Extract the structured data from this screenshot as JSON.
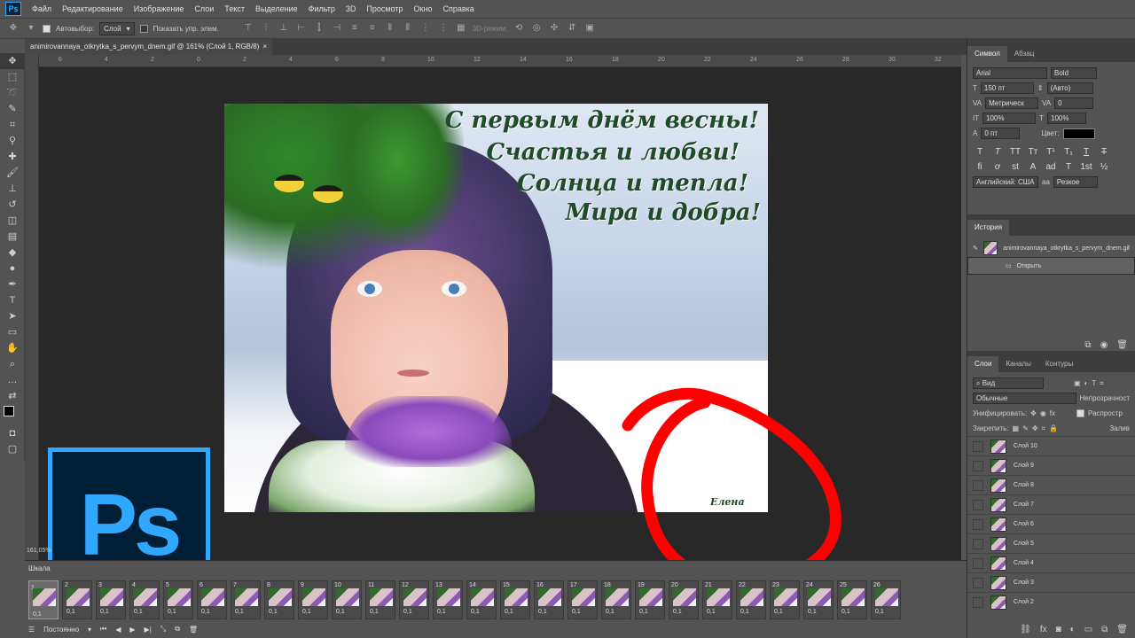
{
  "app": {
    "logo": "Ps"
  },
  "menu": [
    "Файл",
    "Редактирование",
    "Изображение",
    "Слои",
    "Текст",
    "Выделение",
    "Фильтр",
    "3D",
    "Просмотр",
    "Окно",
    "Справка"
  ],
  "options": {
    "autoselect_label": "Автовыбор:",
    "autoselect_value": "Слой",
    "show_controls_label": "Показать упр. элем.",
    "mode3d_label": "3D-режим:"
  },
  "document": {
    "tab_title": "animirovannaya_otkrytka_s_pervym_dnem.gif @ 161% (Слой 1, RGB/8)",
    "zoom_status": "161,05%"
  },
  "ruler_ticks": [
    "6",
    "4",
    "2",
    "0",
    "2",
    "4",
    "6",
    "8",
    "10",
    "12",
    "14",
    "16",
    "18",
    "20",
    "22",
    "24",
    "26",
    "28",
    "30",
    "32"
  ],
  "artwork": {
    "greeting_lines": [
      "С первым днём весны!",
      "Счастья и любви!",
      "Солнца и тепла!",
      "Мира и добра!"
    ],
    "signature": "Елена"
  },
  "timeline": {
    "title": "Шкала",
    "frame_delay": "0,1",
    "frames": [
      "1",
      "2",
      "3",
      "4",
      "5",
      "6",
      "7",
      "8",
      "9",
      "10",
      "11",
      "12",
      "13",
      "14",
      "15",
      "16",
      "17",
      "18",
      "19",
      "20",
      "21",
      "22",
      "23",
      "24",
      "25",
      "26"
    ],
    "loop_option": "Постоянно"
  },
  "character_panel": {
    "tabs": [
      "Символ",
      "Абзац"
    ],
    "font_family": "Arial",
    "font_style": "Bold",
    "font_size": "150 пт",
    "leading": "(Авто)",
    "kerning": "Метрическ",
    "tracking": "0",
    "vscale": "100%",
    "hscale": "100%",
    "baseline": "0 пт",
    "color_label": "Цвет:",
    "color": "#000000",
    "language": "Английский: США",
    "antialias": "Резкое"
  },
  "history_panel": {
    "tab": "История",
    "items": [
      "animirovannaya_otkrytka_s_pervym_dnem.gif",
      "Открыть"
    ]
  },
  "layers_panel": {
    "tabs": [
      "Слои",
      "Каналы",
      "Контуры"
    ],
    "filter": "Вид",
    "blend_mode": "Обычные",
    "opacity_label": "Непрозрачност",
    "unify_label": "Унифицировать:",
    "propagate_label": "Распростр",
    "lock_label": "Закрепить:",
    "fill_label": "Залив",
    "layers": [
      "Слой 10",
      "Слой 9",
      "Слой 8",
      "Слой 7",
      "Слой 6",
      "Слой 5",
      "Слой 4",
      "Слой 3",
      "Слой 2"
    ]
  },
  "colors": {
    "accent_ps": "#31a8ff",
    "annotation_red": "#ff0000"
  }
}
